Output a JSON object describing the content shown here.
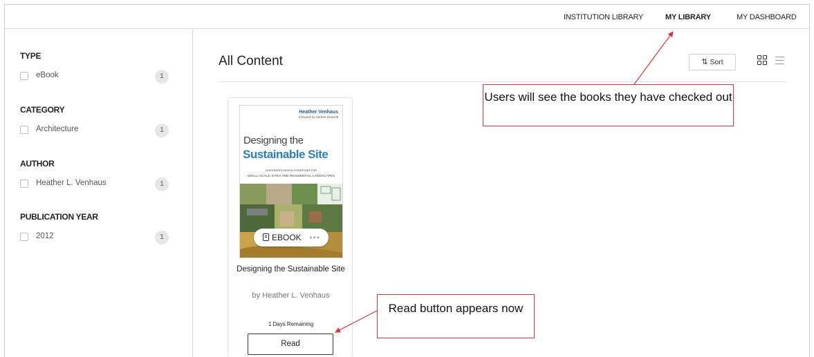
{
  "topnav": {
    "links": [
      "INSTITUTION LIBRARY",
      "MY LIBRARY",
      "MY DASHBOARD"
    ],
    "active": "MY LIBRARY"
  },
  "sidebar": {
    "facets": [
      {
        "heading": "TYPE",
        "options": [
          {
            "label": "eBook",
            "count": "1"
          }
        ]
      },
      {
        "heading": "CATEGORY",
        "options": [
          {
            "label": "Architecture",
            "count": "1"
          }
        ]
      },
      {
        "heading": "AUTHOR",
        "options": [
          {
            "label": "Heather L. Venhaus",
            "count": "1"
          }
        ]
      },
      {
        "heading": "PUBLICATION YEAR",
        "options": [
          {
            "label": "2012",
            "count": "1"
          }
        ]
      }
    ]
  },
  "main": {
    "title": "All Content",
    "sort_label": "Sort",
    "icons": {
      "sort": "sort-icon",
      "grid": "grid-view-icon",
      "list": "list-view-icon"
    }
  },
  "book": {
    "cover": {
      "author": "Heather Venhaus",
      "foreword": "foreword by Herbert Dreiseitl",
      "title_line1": "Designing the",
      "title_line2": "Sustainable Site",
      "subtitle_line1": "INTEGRATED DESIGN STRATEGIES FOR",
      "subtitle_line2": "SMALL-SCALE SITES AND RESIDENTIAL LANDSCAPES"
    },
    "badge": "EBOOK",
    "title": "Designing the Sustainable Site",
    "author_line": "by Heather L. Venhaus",
    "remaining": "1 Days Remaining",
    "read_label": "Read"
  },
  "annotations": {
    "callout_1": "Users will see the books they have checked out",
    "callout_2": "Read button appears now",
    "color": "#d4373b"
  }
}
